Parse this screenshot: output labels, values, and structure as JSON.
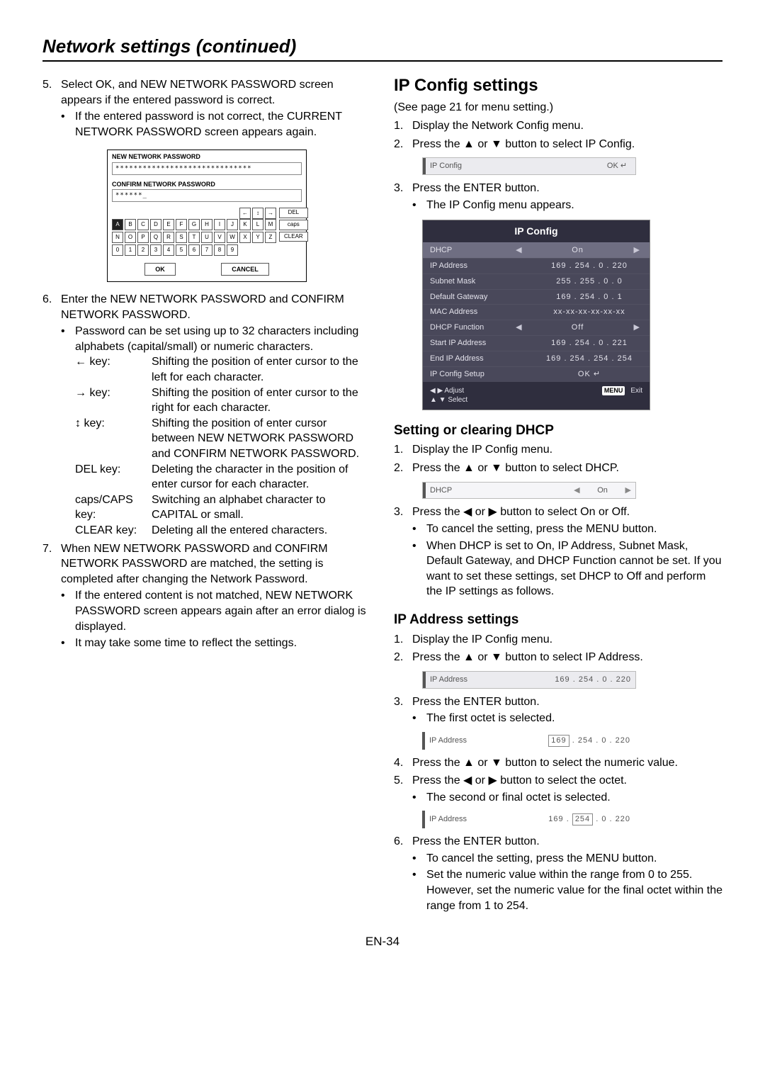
{
  "page_title": "Network settings (continued)",
  "page_number": "EN-34",
  "left": {
    "step5": {
      "num": "5.",
      "text": "Select OK, and NEW NETWORK PASSWORD screen appears if the entered password is correct.",
      "bullet": "If the entered password is not correct, the CURRENT NETWORK PASSWORD screen appears again."
    },
    "pwdialog": {
      "new_label": "NEW NETWORK PASSWORD",
      "new_value": "******************************",
      "confirm_label": "CONFIRM NETWORK PASSWORD",
      "confirm_value": "******_",
      "row1": [
        "A",
        "B",
        "C",
        "D",
        "E",
        "F",
        "G",
        "H",
        "I",
        "J",
        "K",
        "L",
        "M"
      ],
      "row2": [
        "N",
        "O",
        "P",
        "Q",
        "R",
        "S",
        "T",
        "U",
        "V",
        "W",
        "X",
        "Y",
        "Z"
      ],
      "row3": [
        "0",
        "1",
        "2",
        "3",
        "4",
        "5",
        "6",
        "7",
        "8",
        "9"
      ],
      "arrows": [
        "←",
        "↕",
        "→"
      ],
      "side": [
        "DEL",
        "caps",
        "CLEAR"
      ],
      "ok": "OK",
      "cancel": "CANCEL"
    },
    "step6": {
      "num": "6.",
      "text": "Enter the NEW NETWORK PASSWORD and CONFIRM NETWORK PASSWORD.",
      "bullet": "Password can be set using up to 32 characters including alphabets (capital/small) or numeric characters."
    },
    "keys": [
      {
        "label": "← key:",
        "desc": "Shifting the position of enter cursor to the left for each character."
      },
      {
        "label": "→ key:",
        "desc": "Shifting the position of enter cursor to the right for each character."
      },
      {
        "label": "↕ key:",
        "desc": "Shifting the position of enter cursor between NEW NETWORK PASSWORD and CONFIRM NETWORK PASSWORD."
      },
      {
        "label": "DEL key:",
        "desc": "Deleting the character in the position of enter cursor for each character."
      },
      {
        "label": "caps/CAPS key:",
        "desc": "Switching an alphabet character to CAPITAL or small."
      },
      {
        "label": "CLEAR key:",
        "desc": "Deleting all the entered characters."
      }
    ],
    "step7": {
      "num": "7.",
      "text": "When NEW NETWORK PASSWORD and CONFIRM NETWORK PASSWORD are matched, the setting is completed after changing the Network Password.",
      "bullet1": "If the entered content is not matched, NEW NETWORK PASSWORD screen appears again after an error dialog is displayed.",
      "bullet2": "It may take some time to reflect the settings."
    }
  },
  "right": {
    "heading": "IP Config settings",
    "subnote": "(See page 21 for menu setting.)",
    "s1": {
      "num": "1.",
      "text": "Display the Network Config menu."
    },
    "s2": {
      "num": "2.",
      "text": "Press the ▲ or ▼ button to select IP Config."
    },
    "row_ipconfig": {
      "name": "IP Config",
      "val": "OK ↵"
    },
    "s3": {
      "num": "3.",
      "text": "Press the ENTER button.",
      "bullet": "The IP Config menu appears."
    },
    "panel": {
      "title": "IP Config",
      "rows": [
        {
          "name": "DHCP",
          "val": "On",
          "sel": true,
          "arrows": true
        },
        {
          "name": "IP Address",
          "val": "169 . 254 .  0  . 220"
        },
        {
          "name": "Subnet Mask",
          "val": "255 . 255 .  0  .  0"
        },
        {
          "name": "Default Gateway",
          "val": "169 . 254 .  0  .  1"
        },
        {
          "name": "MAC Address",
          "val": "xx-xx-xx-xx-xx-xx"
        },
        {
          "name": "DHCP Function",
          "val": "Off",
          "arrows": true
        },
        {
          "name": "Start IP Address",
          "val": "169 . 254 .  0  . 221"
        },
        {
          "name": "End IP Address",
          "val": "169 . 254 . 254 . 254"
        },
        {
          "name": "IP Config Setup",
          "val": "OK ↵"
        }
      ],
      "footer": {
        "adjust": "◀ ▶ Adjust",
        "select": "▲ ▼ Select",
        "menu": "MENU",
        "exit": "Exit"
      }
    },
    "dhcp_heading": "Setting or clearing DHCP",
    "d1": {
      "num": "1.",
      "text": "Display the IP Config menu."
    },
    "d2": {
      "num": "2.",
      "text": "Press the ▲ or ▼ button to select DHCP."
    },
    "row_dhcp": {
      "name": "DHCP",
      "val": "On"
    },
    "d3": {
      "num": "3.",
      "text": "Press the ◀ or ▶ button to select On or Off.",
      "b1": "To cancel the setting, press the MENU button.",
      "b2": "When DHCP is set to On, IP Address, Subnet Mask, Default Gateway, and DHCP Function cannot be set. If you want to set these settings, set DHCP to Off and perform the IP settings as follows."
    },
    "ipaddr_heading": "IP Address settings",
    "i1": {
      "num": "1.",
      "text": "Display the IP Config menu."
    },
    "i2": {
      "num": "2.",
      "text": "Press the ▲ or ▼ button to select IP Address."
    },
    "row_ip1": {
      "name": "IP Address",
      "val": "169 . 254 .  0  . 220"
    },
    "i3": {
      "num": "3.",
      "text": "Press the ENTER button.",
      "bullet": "The first octet is selected."
    },
    "row_ip2": {
      "name": "IP Address",
      "val_box": "169",
      "rest": ". 254 .  0  . 220"
    },
    "i4": {
      "num": "4.",
      "text": "Press the ▲ or ▼ button to select the numeric value."
    },
    "i5": {
      "num": "5.",
      "text": "Press the ◀ or ▶ button to select the octet.",
      "bullet": "The second or final octet is selected."
    },
    "row_ip3": {
      "name": "IP Address",
      "pre": "169 .",
      "val_box": "254",
      "rest": ".  0  . 220"
    },
    "i6": {
      "num": "6.",
      "text": "Press the ENTER button.",
      "b1": "To cancel the setting, press the MENU button.",
      "b2": "Set the numeric value within the range from 0 to 255. However, set the numeric value for the final octet within the range from 1 to 254."
    }
  }
}
